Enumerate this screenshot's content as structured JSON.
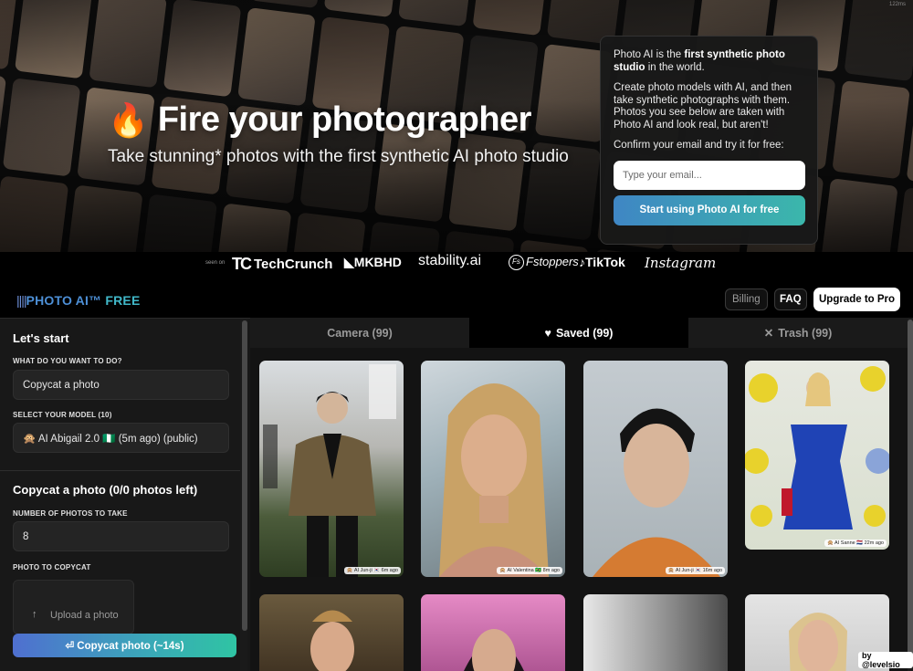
{
  "hero": {
    "emoji": "🔥",
    "title": "Fire your photographer",
    "subtitle": "Take stunning* photos with the first synthetic AI photo studio"
  },
  "signup": {
    "intro_pre": "Photo AI is the ",
    "intro_bold": "first synthetic photo studio",
    "intro_post": " in the world.",
    "description": "Create photo models with AI, and then take synthetic photographs with them. Photos you see below are taken with Photo AI and look real, but aren't!",
    "confirm_text": "Confirm your email and try it for free:",
    "email_placeholder": "Type your email...",
    "start_button": "Start using Photo AI for free"
  },
  "corner_text": "122ms",
  "seen_on": {
    "label": "seen on",
    "logos": {
      "techcrunch": "TechCrunch",
      "mkbhd": "MKBHD",
      "stability": "stability.ai",
      "fstoppers": "Fstoppers",
      "tiktok": "TikTok",
      "instagram": "Instagram"
    }
  },
  "appbar": {
    "brand_bars": "||||",
    "brand_name": "PHOTO AI™",
    "brand_plan": "FREE",
    "billing": "Billing",
    "faq": "FAQ",
    "upgrade": "Upgrade to Pro"
  },
  "sidebar": {
    "lets_start": "Let's start",
    "what_label": "WHAT DO YOU WANT TO DO?",
    "what_value": "Copycat a photo",
    "model_label": "SELECT YOUR MODEL (10)",
    "model_value": "🙊 AI Abigail 2.0 🇳🇬 (5m ago) (public)",
    "copycat_title": "Copycat a photo (0/0 photos left)",
    "num_label": "NUMBER OF PHOTOS TO TAKE",
    "num_value": "8",
    "photo_label": "PHOTO TO COPYCAT",
    "upload_text": "Upload a photo",
    "copy_button": "⏎ Copycat photo (~14s)"
  },
  "tabs": [
    {
      "label": "Camera (99)",
      "icon": "camera-icon",
      "active": false
    },
    {
      "label": "Saved (99)",
      "icon": "heart-icon",
      "active": true
    },
    {
      "label": "Trash (99)",
      "icon": "x-icon",
      "active": false
    }
  ],
  "photos": [
    {
      "caption": "🙊 AI Jun-ji 🇰🇷 6m ago"
    },
    {
      "caption": "🙊 AI Valentina 🇧🇷 8m ago"
    },
    {
      "caption": "🙊 AI Jun-ji 🇰🇷 16m ago"
    },
    {
      "caption": "🙊 AI Sanne 🇳🇱 22m ago"
    },
    {
      "caption": ""
    },
    {
      "caption": ""
    },
    {
      "caption": ""
    },
    {
      "caption": ""
    }
  ],
  "by_badge": "by @levelsio"
}
